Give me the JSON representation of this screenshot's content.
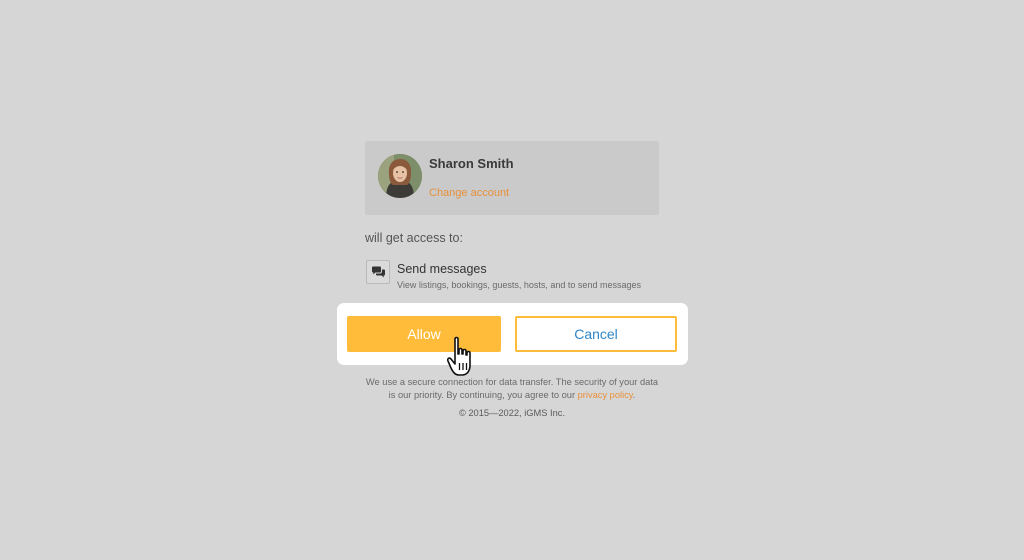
{
  "account": {
    "name": "Sharon Smith",
    "change_label": "Change account"
  },
  "access": {
    "intro": "will get access to:",
    "permissions": [
      {
        "icon": "chat-bubbles-icon",
        "title": "Send messages",
        "description": "View listings, bookings, guests, hosts, and to send messages"
      }
    ]
  },
  "actions": {
    "allow_label": "Allow",
    "cancel_label": "Cancel"
  },
  "footer": {
    "security_text": "We use a secure connection for data transfer. The security of your data is our priority. By continuing, you agree to our",
    "privacy_link": "privacy policy",
    "period": ".",
    "copyright": "© 2015—2022, iGMS Inc."
  },
  "colors": {
    "background": "#d6d6d6",
    "card": "#cacaca",
    "accent": "#ffbc3a",
    "link_orange": "#e8903a",
    "link_blue": "#2e86c8"
  }
}
